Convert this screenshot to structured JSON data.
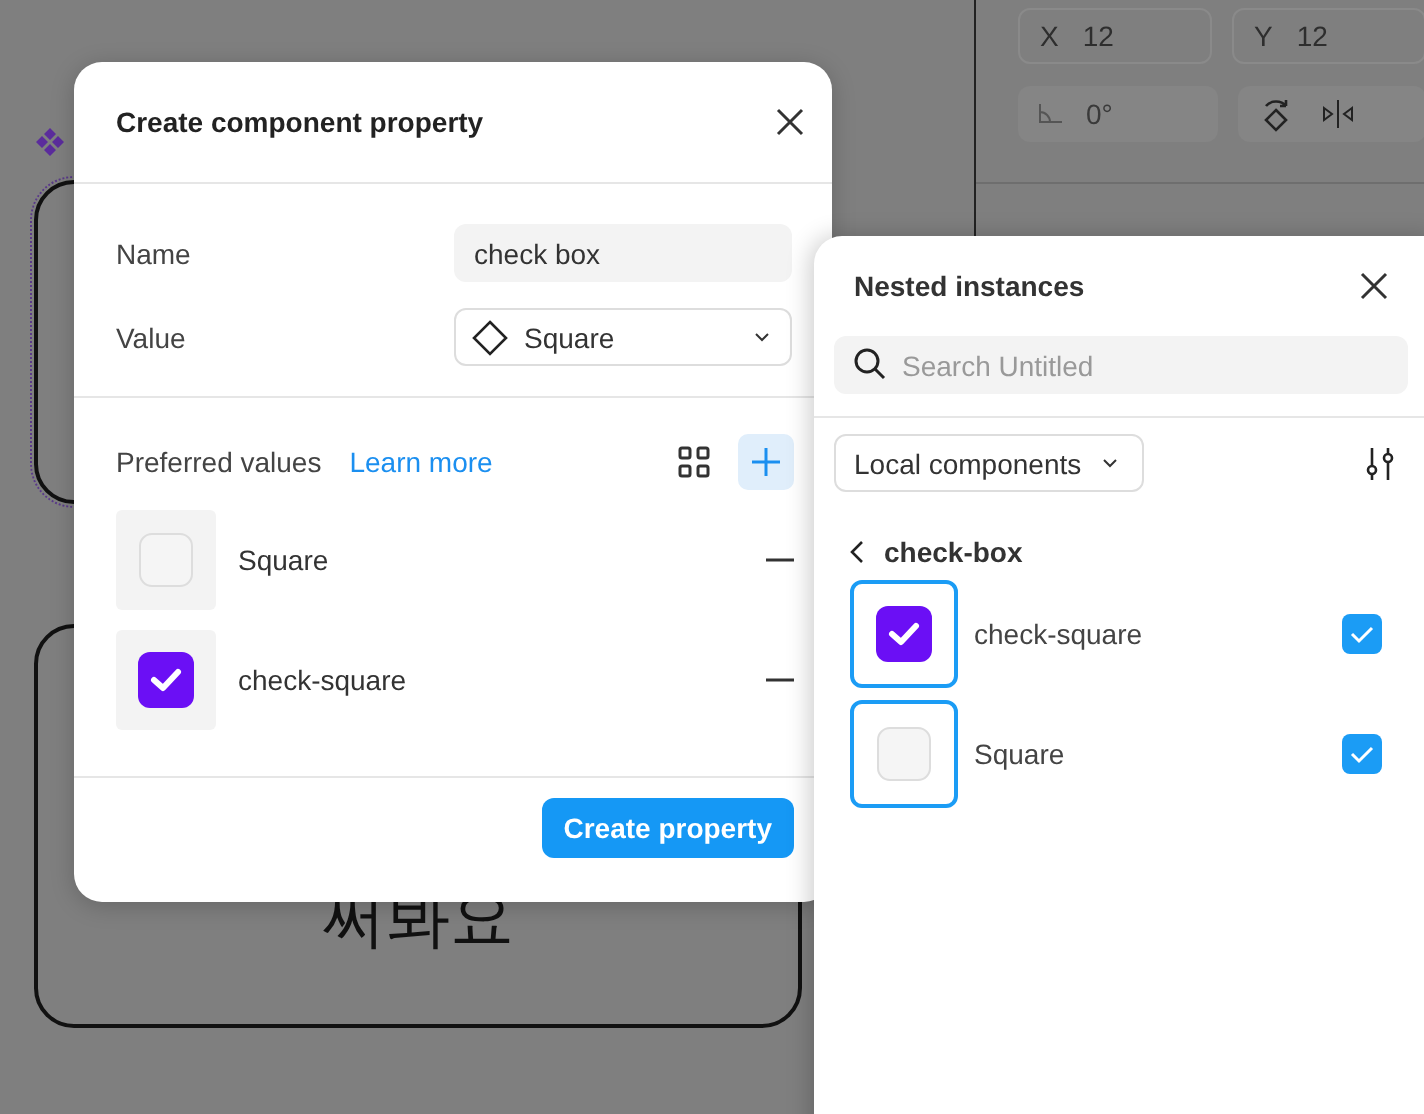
{
  "canvas": {
    "text": "써봐요"
  },
  "properties": {
    "fields": [
      {
        "label": "X",
        "value": "12"
      },
      {
        "label": "Y",
        "value": "12"
      }
    ],
    "rotation": "0°"
  },
  "dialog": {
    "title": "Create component property",
    "name": {
      "label": "Name",
      "value": "check box"
    },
    "value": {
      "label": "Value",
      "option": "Square"
    },
    "preferred": {
      "label": "Preferred values",
      "link": "Learn more",
      "items": [
        {
          "name": "Square",
          "checked": false
        },
        {
          "name": "check-square",
          "checked": true
        }
      ]
    },
    "button": "Create property"
  },
  "nested": {
    "title": "Nested instances",
    "search": {
      "placeholder": "Search Untitled"
    },
    "filter": "Local components",
    "back": "check-box",
    "items": [
      {
        "name": "check-square",
        "checked": true,
        "selected": true
      },
      {
        "name": "Square",
        "checked": false,
        "selected": true
      }
    ]
  }
}
